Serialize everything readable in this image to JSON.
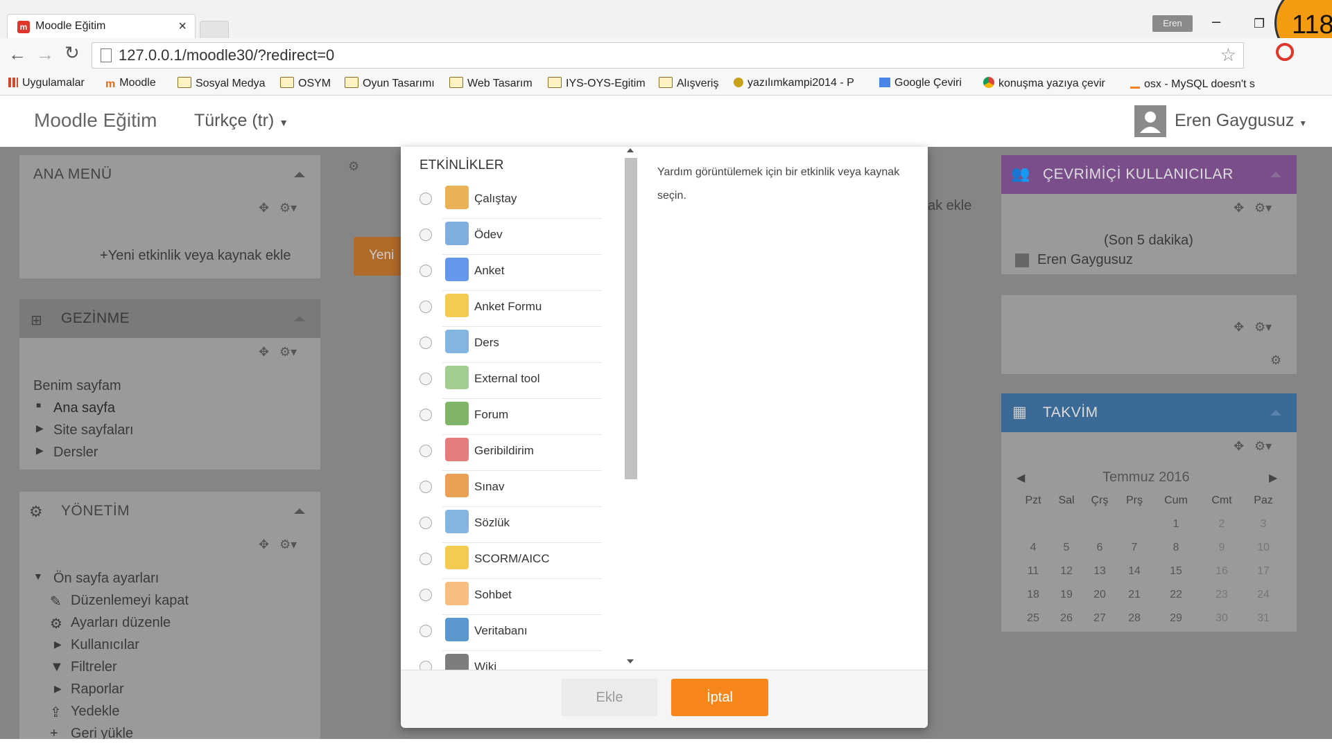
{
  "browser": {
    "tab_title": "Moodle Eğitim",
    "user_badge": "Eren",
    "counter": "118",
    "url": "127.0.0.1/moodle30/?redirect=0",
    "bookmarks": [
      "Uygulamalar",
      "Moodle",
      "Sosyal Medya",
      "OSYM",
      "Oyun Tasarımı",
      "Web Tasarım",
      "IYS-OYS-Egitim",
      "Alışveriş",
      "yazılımkampi2014 - P",
      "Google Çeviri",
      "konuşma yazıya çevir",
      "osx - MySQL doesn't s"
    ]
  },
  "header": {
    "brand": "Moodle Eğitim",
    "language": "Türkçe (tr)",
    "user_name": "Eren Gaygusuz"
  },
  "left": {
    "main_menu": {
      "title": "ANA MENÜ",
      "add_link": "Yeni etkinlik veya kaynak ekle"
    },
    "navigation": {
      "title": "GEZİNME",
      "items": [
        "Benim sayfam",
        "Ana sayfa",
        "Site sayfaları",
        "Dersler"
      ]
    },
    "admin": {
      "title": "YÖNETİM",
      "items": [
        "Ön sayfa ayarları",
        "Düzenlemeyi kapat",
        "Ayarları düzenle",
        "Kullanıcılar",
        "Filtreler",
        "Raporlar",
        "Yedekle",
        "Geri yükle"
      ]
    }
  },
  "center": {
    "yeni_button": "Yeni",
    "add_partial": "ak ekle"
  },
  "modal": {
    "list_heading": "ETKİNLİKLER",
    "activities": [
      "Çalıştay",
      "Ödev",
      "Anket",
      "Anket Formu",
      "Ders",
      "External tool",
      "Forum",
      "Geribildirim",
      "Sınav",
      "Sözlük",
      "SCORM/AICC",
      "Sohbet",
      "Veritabanı",
      "Wiki"
    ],
    "help_text": "Yardım görüntülemek için bir etkinlik veya kaynak seçin.",
    "add_button": "Ekle",
    "cancel_button": "İptal"
  },
  "right": {
    "online": {
      "title": "ÇEVRİMİÇİ KULLANICILAR",
      "period": "(Son 5 dakika)",
      "user": "Eren Gaygusuz",
      "color": "#9b59b6"
    },
    "calendar": {
      "title": "TAKVİM",
      "color": "#5b9bd5",
      "month": "Temmuz 2016",
      "days": [
        "Pzt",
        "Sal",
        "Çrş",
        "Prş",
        "Cum",
        "Cmt",
        "Paz"
      ],
      "weeks": [
        [
          "",
          "",
          "",
          "",
          "1",
          "2",
          "3"
        ],
        [
          "4",
          "5",
          "6",
          "7",
          "8",
          "9",
          "10"
        ],
        [
          "11",
          "12",
          "13",
          "14",
          "15",
          "16",
          "17"
        ],
        [
          "18",
          "19",
          "20",
          "21",
          "22",
          "23",
          "24"
        ],
        [
          "25",
          "26",
          "27",
          "28",
          "29",
          "30",
          "31"
        ]
      ]
    }
  },
  "colors": {
    "accent_orange": "#f7861b",
    "overlay": "#858585"
  }
}
